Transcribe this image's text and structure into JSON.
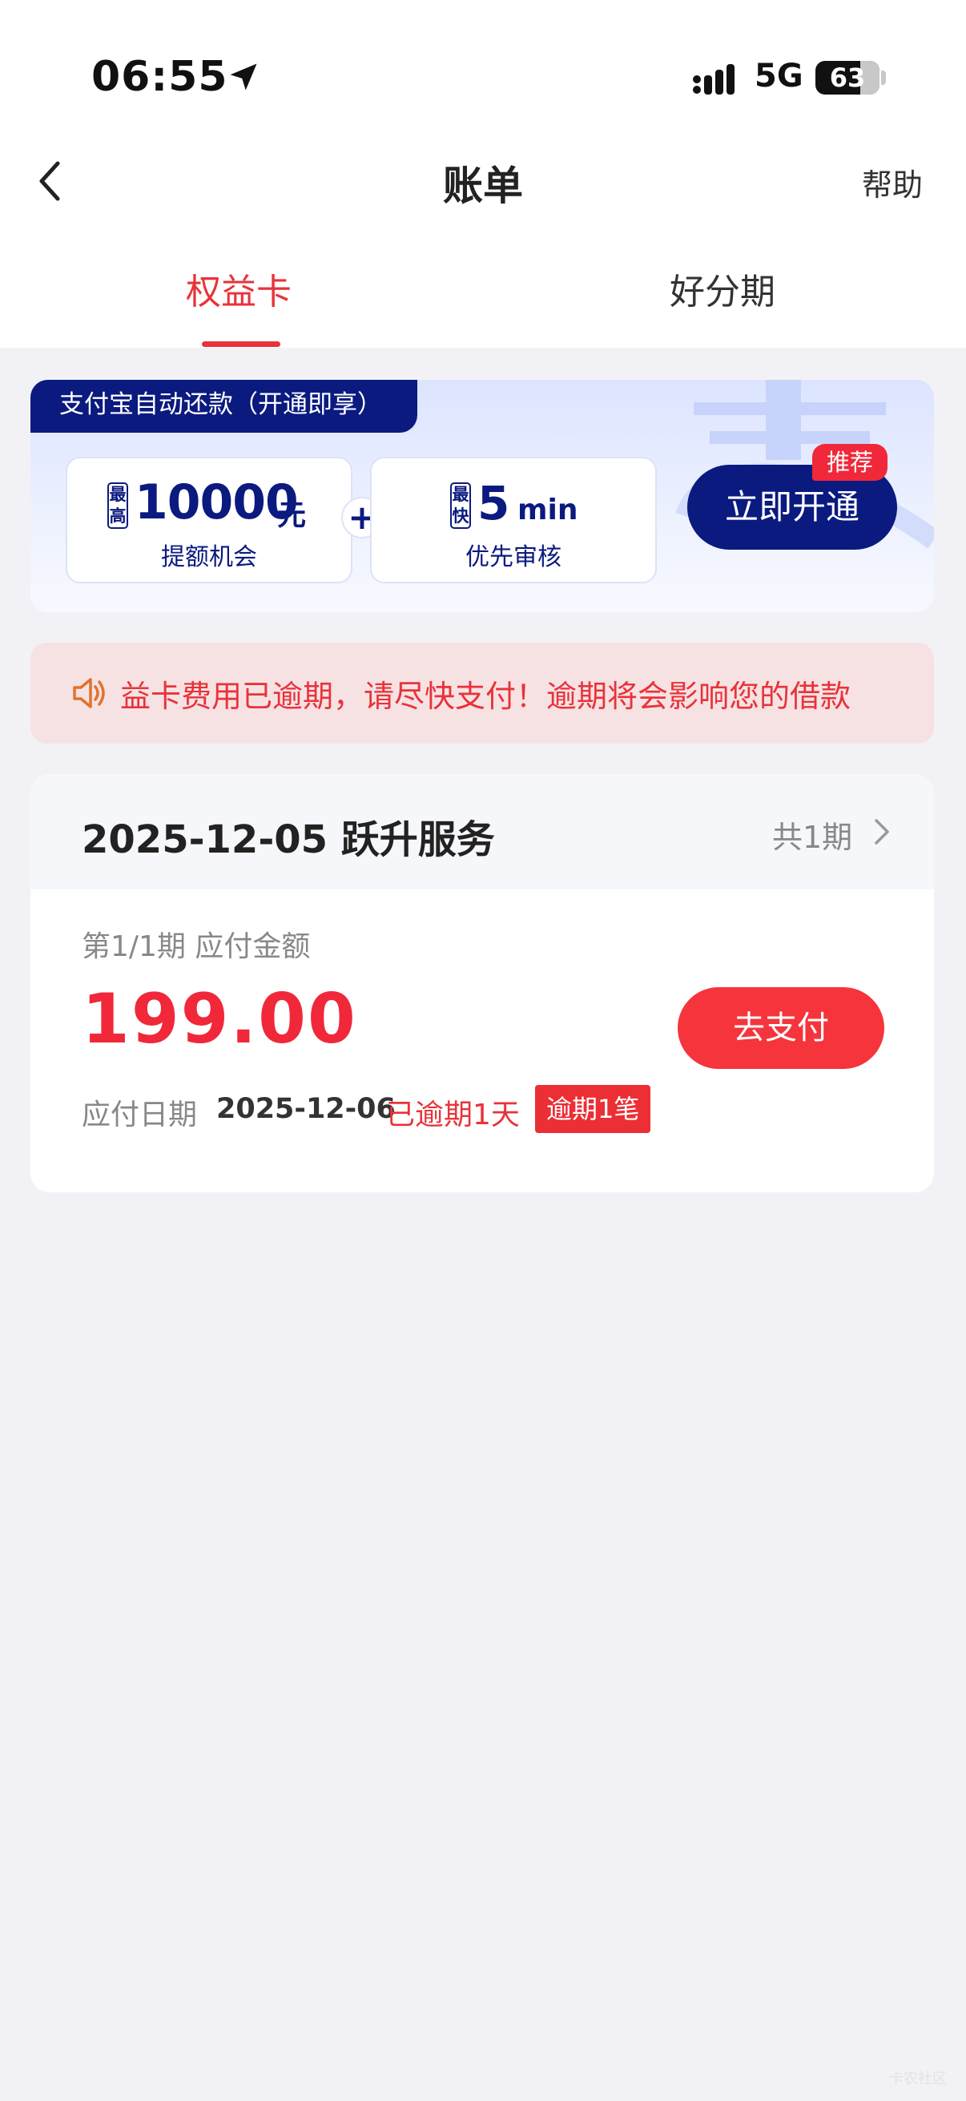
{
  "status_bar": {
    "time": "06:55",
    "network": "5G",
    "battery": "63",
    "icons": [
      "location-arrow-icon",
      "signal-icon",
      "battery-icon"
    ]
  },
  "nav": {
    "title": "账单",
    "help": "帮助",
    "icons": [
      "chevron-left-icon"
    ]
  },
  "tabs": [
    {
      "label": "权益卡",
      "active": true
    },
    {
      "label": "好分期",
      "active": false
    }
  ],
  "promo": {
    "tag": "支付宝自动还款（开通即享）",
    "card1": {
      "badge": "最高",
      "value": "10000",
      "unit": "元",
      "label": "提额机会"
    },
    "card2": {
      "badge": "最快",
      "value": "5",
      "unit": "min",
      "label": "优先审核"
    },
    "plus": "+",
    "button": "立即开通",
    "recommend": "推荐"
  },
  "notice": {
    "text": "益卡费用已逾期，请尽快支付！逾期将会影响您的借款",
    "icon": "speaker-icon"
  },
  "bill": {
    "title": "2025-12-05 跃升服务",
    "count": "共1期",
    "period": "第1/1期 应付金额",
    "amount": "199.00",
    "pay_button": "去支付",
    "due_label": "应付日期",
    "due_date": "2025-12-06",
    "overdue_text": "已逾期1天",
    "overdue_badge": "逾期1笔"
  },
  "watermark": "卡农社区",
  "colors": {
    "accent_red": "#E8333B",
    "navy": "#0B1A7F",
    "background": "#F2F2F6"
  }
}
